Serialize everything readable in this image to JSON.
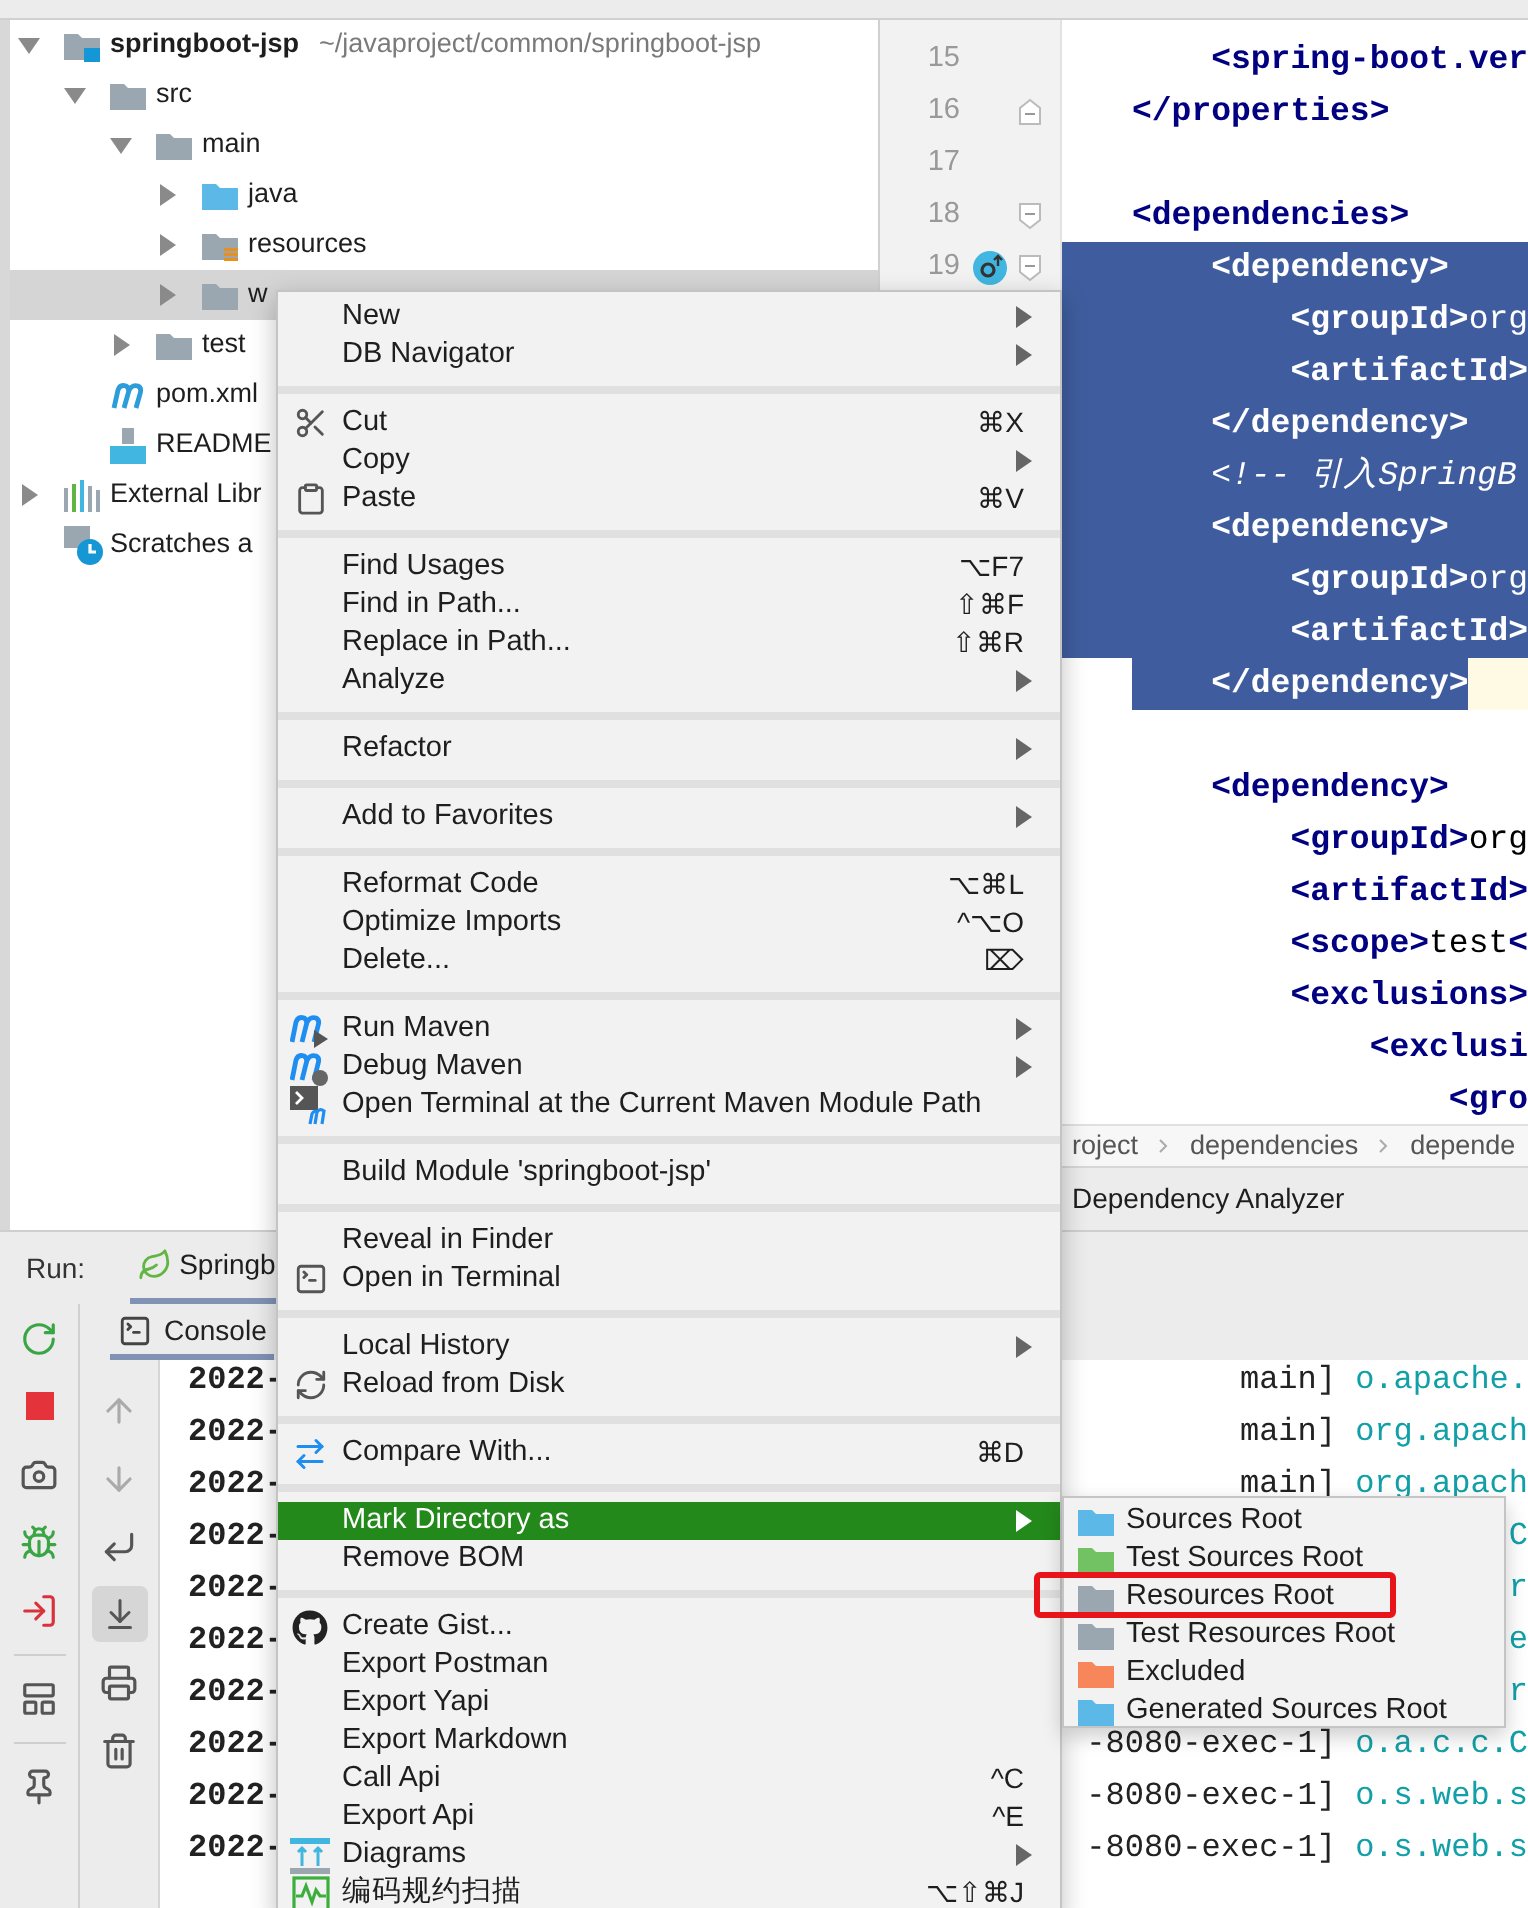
{
  "tree": [
    {
      "label": "springboot-jsp",
      "path": "~/javaproject/common/springboot-jsp",
      "kind": "module",
      "expanded": true,
      "selected": false,
      "children": [
        {
          "label": "src",
          "kind": "folder",
          "expanded": true,
          "selected": false,
          "children": [
            {
              "label": "main",
              "kind": "folder",
              "expanded": true,
              "selected": false,
              "children": [
                {
                  "label": "java",
                  "kind": "source-folder",
                  "expanded": false,
                  "selected": false
                },
                {
                  "label": "resources",
                  "kind": "resource-folder",
                  "expanded": false,
                  "selected": false
                },
                {
                  "label": "w",
                  "kind": "folder",
                  "expanded": false,
                  "selected": true
                }
              ]
            },
            {
              "label": "test",
              "kind": "folder",
              "expanded": false,
              "selected": false
            }
          ]
        },
        {
          "label": "pom.xml",
          "kind": "maven-file",
          "selected": false
        },
        {
          "label": "README",
          "kind": "markdown-file",
          "selected": false
        }
      ]
    },
    {
      "label": "External Libr",
      "kind": "libraries",
      "expanded": false,
      "selected": false
    },
    {
      "label": "Scratches a",
      "kind": "scratches",
      "selected": false
    }
  ],
  "editor": {
    "lines": [
      {
        "number": "15",
        "selected": false,
        "tokens": [
          {
            "kind": "tag",
            "text": "    <spring-boot.ver"
          }
        ]
      },
      {
        "number": "16",
        "fold_end": true,
        "selected": false,
        "tokens": [
          {
            "kind": "tag",
            "text": "</properties>"
          }
        ]
      },
      {
        "number": "17",
        "selected": false
      },
      {
        "number": "18",
        "fold_start": true,
        "selected": false,
        "tokens": [
          {
            "kind": "tag",
            "text": "<dependencies>"
          }
        ]
      },
      {
        "number": "19",
        "fold_start": true,
        "selected": true,
        "tokens": [
          {
            "kind": "tag",
            "text": "    <dependency>"
          }
        ]
      },
      {
        "selected": true,
        "tokens": [
          {
            "kind": "tag",
            "text": "        <groupId>"
          },
          {
            "kind": "text",
            "text": "org"
          }
        ]
      },
      {
        "selected": true,
        "tokens": [
          {
            "kind": "tag",
            "text": "        <artifactId>"
          }
        ]
      },
      {
        "selected": true,
        "tokens": [
          {
            "kind": "tag",
            "text": "    </dependency>"
          }
        ]
      },
      {
        "selected": true,
        "tokens": [
          {
            "kind": "comment",
            "text": "    <!-- 引入SpringB"
          }
        ]
      },
      {
        "selected": true,
        "tokens": [
          {
            "kind": "tag",
            "text": "    <dependency>"
          }
        ]
      },
      {
        "selected": true,
        "tokens": [
          {
            "kind": "tag",
            "text": "        <groupId>"
          },
          {
            "kind": "text",
            "text": "org"
          }
        ]
      },
      {
        "selected": true,
        "tokens": [
          {
            "kind": "tag",
            "text": "        <artifactId>"
          }
        ]
      },
      {
        "selected": true,
        "current": true,
        "tokens": [
          {
            "kind": "tag",
            "text": "    </dependency>"
          }
        ]
      },
      {
        "selected": false
      },
      {
        "selected": false,
        "tokens": [
          {
            "kind": "tag",
            "text": "    <dependency>"
          }
        ]
      },
      {
        "selected": false,
        "tokens": [
          {
            "kind": "tag",
            "text": "        <groupId>"
          },
          {
            "kind": "text",
            "text": "org"
          }
        ]
      },
      {
        "selected": false,
        "tokens": [
          {
            "kind": "tag",
            "text": "        <artifactId>"
          }
        ]
      },
      {
        "selected": false,
        "tokens": [
          {
            "kind": "tag",
            "text": "        <scope>"
          },
          {
            "kind": "text",
            "text": "test"
          },
          {
            "kind": "tag",
            "text": "<"
          }
        ]
      },
      {
        "selected": false,
        "tokens": [
          {
            "kind": "tag",
            "text": "        <exclusions>"
          }
        ]
      },
      {
        "selected": false,
        "tokens": [
          {
            "kind": "tag",
            "text": "            <exclusi"
          }
        ]
      },
      {
        "selected": false,
        "tokens": [
          {
            "kind": "tag",
            "text": "                <gro"
          }
        ]
      }
    ],
    "breadcrumbs": [
      "roject",
      "dependencies",
      "depende"
    ],
    "tool_tab": "Dependency Analyzer"
  },
  "run": {
    "label": "Run:",
    "tab": "Springb"
  },
  "console": {
    "tab": "Console",
    "autoscroll": true,
    "lines": [
      {
        "left": "2022-",
        "right": [
          {
            "kind": "thread",
            "text": "main] "
          },
          {
            "kind": "logger",
            "text": "o.apache."
          }
        ]
      },
      {
        "left": "2022-",
        "right": [
          {
            "kind": "thread",
            "text": "main] "
          },
          {
            "kind": "logger",
            "text": "org.apach"
          }
        ]
      },
      {
        "left": "2022-",
        "right": [
          {
            "kind": "thread",
            "text": "main] "
          },
          {
            "kind": "logger",
            "text": "org.apach"
          }
        ]
      },
      {
        "left": "2022-",
        "right": [
          {
            "kind": "logger",
            "text": "C"
          }
        ]
      },
      {
        "left": "2022-",
        "right": [
          {
            "kind": "logger",
            "text": "r"
          }
        ]
      },
      {
        "left": "2022-",
        "right": [
          {
            "kind": "logger",
            "text": "e"
          }
        ]
      },
      {
        "left": "2022-",
        "right": [
          {
            "kind": "logger",
            "text": "r"
          }
        ]
      },
      {
        "left": "2022-",
        "right": [
          {
            "kind": "thread",
            "text": "-8080-exec-1] "
          },
          {
            "kind": "logger",
            "text": "o.a.c.c.C"
          }
        ]
      },
      {
        "left": "2022-",
        "right": [
          {
            "kind": "thread",
            "text": "-8080-exec-1] "
          },
          {
            "kind": "logger",
            "text": "o.s.web.s"
          }
        ]
      },
      {
        "left": "2022-",
        "right": [
          {
            "kind": "thread",
            "text": "-8080-exec-1] "
          },
          {
            "kind": "logger",
            "text": "o.s.web.s"
          }
        ]
      }
    ]
  },
  "context_menu": {
    "groups": [
      [
        {
          "label": "New",
          "submenu": true,
          "selected": false
        },
        {
          "label": "DB Navigator",
          "submenu": true,
          "selected": false
        }
      ],
      [
        {
          "label": "Cut",
          "shortcut": "⌘X",
          "submenu": false,
          "selected": false
        },
        {
          "label": "Copy",
          "submenu": true,
          "selected": false
        },
        {
          "label": "Paste",
          "shortcut": "⌘V",
          "submenu": false,
          "selected": false
        }
      ],
      [
        {
          "label": "Find Usages",
          "shortcut": "⌥F7",
          "submenu": false,
          "selected": false
        },
        {
          "label": "Find in Path...",
          "shortcut": "⇧⌘F",
          "submenu": false,
          "selected": false
        },
        {
          "label": "Replace in Path...",
          "shortcut": "⇧⌘R",
          "submenu": false,
          "selected": false
        },
        {
          "label": "Analyze",
          "submenu": true,
          "selected": false
        }
      ],
      [
        {
          "label": "Refactor",
          "submenu": true,
          "selected": false
        }
      ],
      [
        {
          "label": "Add to Favorites",
          "submenu": true,
          "selected": false
        }
      ],
      [
        {
          "label": "Reformat Code",
          "shortcut": "⌥⌘L",
          "submenu": false,
          "selected": false
        },
        {
          "label": "Optimize Imports",
          "shortcut": "^⌥O",
          "submenu": false,
          "selected": false
        },
        {
          "label": "Delete...",
          "shortcut": "⌦",
          "submenu": false,
          "selected": false
        }
      ],
      [
        {
          "label": "Run Maven",
          "submenu": true,
          "selected": false
        },
        {
          "label": "Debug Maven",
          "submenu": true,
          "selected": false
        },
        {
          "label": "Open Terminal at the Current Maven Module Path",
          "submenu": false,
          "selected": false
        }
      ],
      [
        {
          "label": "Build Module 'springboot-jsp'",
          "submenu": false,
          "selected": false
        }
      ],
      [
        {
          "label": "Reveal in Finder",
          "submenu": false,
          "selected": false
        },
        {
          "label": "Open in Terminal",
          "submenu": false,
          "selected": false
        }
      ],
      [
        {
          "label": "Local History",
          "submenu": true,
          "selected": false
        },
        {
          "label": "Reload from Disk",
          "submenu": false,
          "selected": false
        }
      ],
      [
        {
          "label": "Compare With...",
          "shortcut": "⌘D",
          "submenu": false,
          "selected": false
        }
      ],
      [
        {
          "label": "Mark Directory as",
          "submenu": true,
          "selected": true
        },
        {
          "label": "Remove BOM",
          "submenu": false,
          "selected": false
        }
      ],
      [
        {
          "label": "Create Gist...",
          "submenu": false,
          "selected": false
        },
        {
          "label": "Export Postman",
          "submenu": false,
          "selected": false
        },
        {
          "label": "Export Yapi",
          "submenu": false,
          "selected": false
        },
        {
          "label": "Export Markdown",
          "submenu": false,
          "selected": false
        },
        {
          "label": "Call Api",
          "shortcut": "^C",
          "submenu": false,
          "selected": false
        },
        {
          "label": "Export Api",
          "shortcut": "^E",
          "submenu": false,
          "selected": false
        },
        {
          "label": "Diagrams",
          "submenu": true,
          "selected": false
        },
        {
          "label": "编码规约扫描",
          "shortcut": "⌥⇧⌘J",
          "submenu": false,
          "selected": false
        }
      ]
    ]
  },
  "mark_directory_menu": {
    "items": [
      {
        "label": "Sources Root",
        "color": "#5cb8e6",
        "annotated": false
      },
      {
        "label": "Test Sources Root",
        "color": "#72c264",
        "annotated": false
      },
      {
        "label": "Resources Root",
        "color": "#9aa7b0",
        "annotated": true
      },
      {
        "label": "Test Resources Root",
        "color": "#9aa7b0",
        "annotated": false
      },
      {
        "label": "Excluded",
        "color": "#f7875a",
        "annotated": false
      },
      {
        "label": "Generated Sources Root",
        "color": "#5cb8e6",
        "annotated": false
      }
    ]
  }
}
